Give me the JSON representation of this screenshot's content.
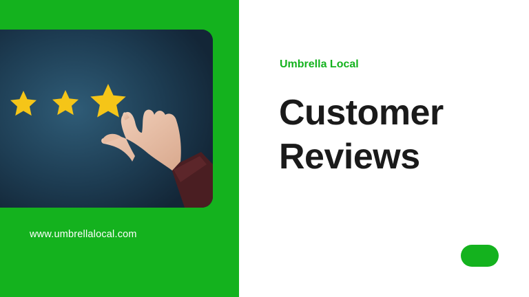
{
  "brand": "Umbrella Local",
  "title": {
    "line1": "Customer",
    "line2": "Reviews"
  },
  "website": "www.umbrellalocal.com",
  "colors": {
    "accent_green": "#14b21e",
    "heading_text": "#1a1a1a",
    "photo_background": "#1f4258",
    "star": "#f5c518"
  },
  "photo": {
    "rating_shown": 3,
    "star_icon": "star-icon",
    "subject": "hand-placing-star"
  }
}
